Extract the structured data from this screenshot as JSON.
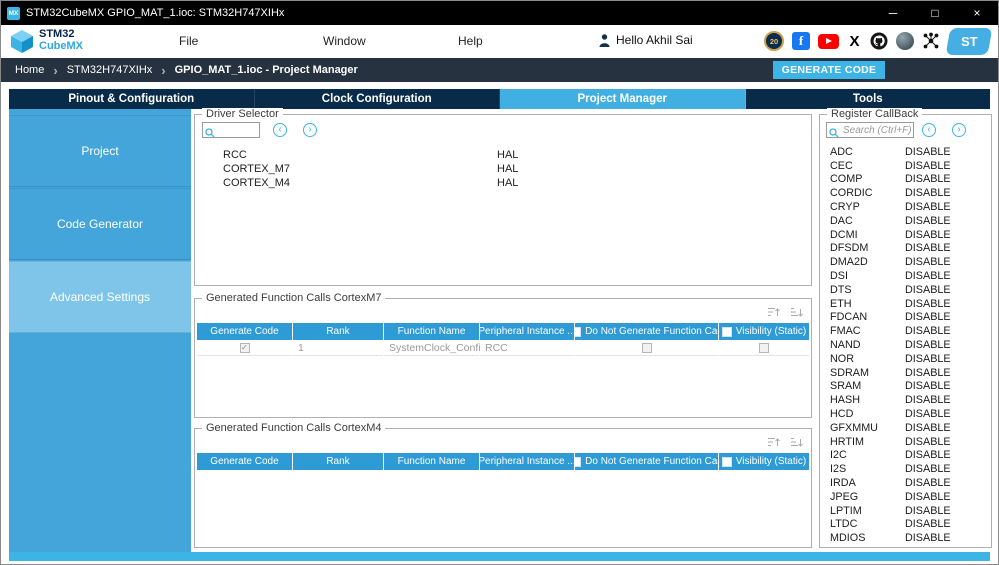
{
  "colors": {
    "accent": "#3CB4E6",
    "navy": "#03234B",
    "table_header_blue": "#2E9BD6",
    "sidebar_blue": "#44A5DB",
    "tabbar_navy": "#082B4A"
  },
  "window": {
    "title": "STM32CubeMX GPIO_MAT_1.ioc: STM32H747XIHx",
    "app_icon": "MX",
    "controls": {
      "minimize": "─",
      "maximize": "□",
      "close": "×"
    }
  },
  "menubar": {
    "brand_top": "STM32",
    "brand_bottom": "CubeMX",
    "items": [
      "File",
      "Window",
      "Help"
    ],
    "greeting": "Hello Akhil Sai"
  },
  "icons": {
    "anniversary_badge": "20",
    "facebook": "f",
    "x_logo": "X",
    "st_logo": "ST"
  },
  "breadcrumb": {
    "items": [
      "Home",
      "STM32H747XIHx",
      "GPIO_MAT_1.ioc - Project Manager"
    ],
    "separator": "›",
    "generate_label": "GENERATE CODE"
  },
  "tabs": [
    {
      "label": "Pinout & Configuration",
      "active": false
    },
    {
      "label": "Clock Configuration",
      "active": false
    },
    {
      "label": "Project Manager",
      "active": true
    },
    {
      "label": "Tools",
      "active": false
    }
  ],
  "sidebar": {
    "items": [
      {
        "label": "Project",
        "selected": false
      },
      {
        "label": "Code Generator",
        "selected": false
      },
      {
        "label": "Advanced Settings",
        "selected": true
      }
    ]
  },
  "driver_selector": {
    "legend": "Driver Selector",
    "search_value": "",
    "rows": [
      {
        "name": "RCC",
        "driver": "HAL"
      },
      {
        "name": "CORTEX_M7",
        "driver": "HAL"
      },
      {
        "name": "CORTEX_M4",
        "driver": "HAL"
      }
    ]
  },
  "calls_m7": {
    "legend": "Generated Function Calls CortexM7",
    "columns": [
      "Generate Code",
      "Rank",
      "Function Name",
      "Peripheral Instance ...",
      "Do Not Generate Function Call",
      "Visibility (Static)"
    ],
    "rows": [
      {
        "generate": true,
        "rank": "1",
        "function": "SystemClock_Config",
        "instance": "RCC",
        "no_call": false,
        "visibility": false
      }
    ]
  },
  "calls_m4": {
    "legend": "Generated Function Calls CortexM4",
    "columns": [
      "Generate Code",
      "Rank",
      "Function Name",
      "Peripheral Instance ...",
      "Do Not Generate Function Call",
      "Visibility (Static)"
    ],
    "rows": []
  },
  "register_callback": {
    "legend": "Register CallBack",
    "search_placeholder": "Search (Ctrl+F)",
    "rows": [
      {
        "name": "ADC",
        "value": "DISABLE"
      },
      {
        "name": "CEC",
        "value": "DISABLE"
      },
      {
        "name": "COMP",
        "value": "DISABLE"
      },
      {
        "name": "CORDIC",
        "value": "DISABLE"
      },
      {
        "name": "CRYP",
        "value": "DISABLE"
      },
      {
        "name": "DAC",
        "value": "DISABLE"
      },
      {
        "name": "DCMI",
        "value": "DISABLE"
      },
      {
        "name": "DFSDM",
        "value": "DISABLE"
      },
      {
        "name": "DMA2D",
        "value": "DISABLE"
      },
      {
        "name": "DSI",
        "value": "DISABLE"
      },
      {
        "name": "DTS",
        "value": "DISABLE"
      },
      {
        "name": "ETH",
        "value": "DISABLE"
      },
      {
        "name": "FDCAN",
        "value": "DISABLE"
      },
      {
        "name": "FMAC",
        "value": "DISABLE"
      },
      {
        "name": "NAND",
        "value": "DISABLE"
      },
      {
        "name": "NOR",
        "value": "DISABLE"
      },
      {
        "name": "SDRAM",
        "value": "DISABLE"
      },
      {
        "name": "SRAM",
        "value": "DISABLE"
      },
      {
        "name": "HASH",
        "value": "DISABLE"
      },
      {
        "name": "HCD",
        "value": "DISABLE"
      },
      {
        "name": "GFXMMU",
        "value": "DISABLE"
      },
      {
        "name": "HRTIM",
        "value": "DISABLE"
      },
      {
        "name": "I2C",
        "value": "DISABLE"
      },
      {
        "name": "I2S",
        "value": "DISABLE"
      },
      {
        "name": "IRDA",
        "value": "DISABLE"
      },
      {
        "name": "JPEG",
        "value": "DISABLE"
      },
      {
        "name": "LPTIM",
        "value": "DISABLE"
      },
      {
        "name": "LTDC",
        "value": "DISABLE"
      },
      {
        "name": "MDIOS",
        "value": "DISABLE"
      }
    ]
  }
}
